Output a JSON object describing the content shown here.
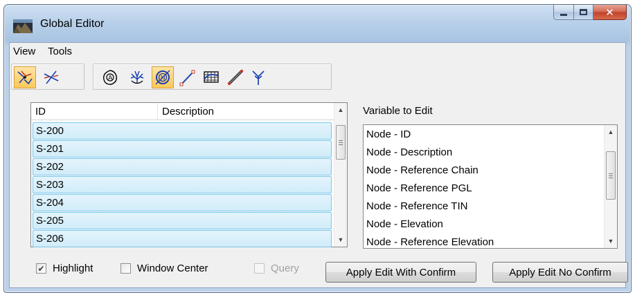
{
  "window": {
    "title": "Global Editor"
  },
  "menu": {
    "items": [
      "View",
      "Tools"
    ]
  },
  "toolbar": {
    "mode_buttons": [
      "xing-select-icon",
      "connect-lines-icon"
    ],
    "element_buttons": [
      "alignment-node-icon",
      "drainage-network-icon",
      "node-icon",
      "link-icon",
      "profile-icon",
      "pipe-icon",
      "outfall-icon"
    ]
  },
  "list": {
    "columns": [
      "ID",
      "Description"
    ],
    "rows": [
      {
        "id": "S-200",
        "description": ""
      },
      {
        "id": "S-201",
        "description": ""
      },
      {
        "id": "S-202",
        "description": ""
      },
      {
        "id": "S-203",
        "description": ""
      },
      {
        "id": "S-204",
        "description": ""
      },
      {
        "id": "S-205",
        "description": ""
      },
      {
        "id": "S-206",
        "description": ""
      }
    ]
  },
  "variables": {
    "label": "Variable to Edit",
    "items": [
      "Node - ID",
      "Node - Description",
      "Node - Reference Chain",
      "Node - Reference PGL",
      "Node - Reference TIN",
      "Node - Elevation",
      "Node - Reference Elevation"
    ]
  },
  "options": {
    "highlight": {
      "label": "Highlight",
      "checked": true
    },
    "window_center": {
      "label": "Window Center",
      "checked": false
    },
    "query": {
      "label": "Query",
      "checked": false,
      "disabled": true
    }
  },
  "buttons": {
    "apply_confirm": "Apply Edit With Confirm",
    "apply_no_confirm": "Apply Edit No Confirm"
  },
  "colors": {
    "row_fill": "#d8effa",
    "row_border": "#7cc6e9",
    "active_tool": "#fcc85a",
    "close_button": "#c9513b"
  }
}
